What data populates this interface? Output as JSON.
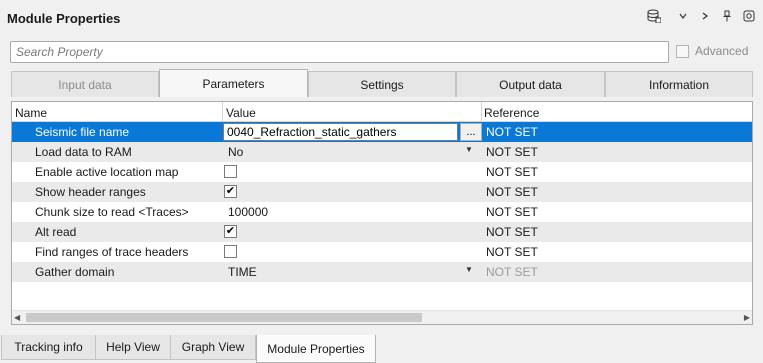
{
  "window": {
    "title": "Module Properties"
  },
  "toolbar_icons": [
    "database-icon",
    "chevron-down-icon",
    "chevron-right-icon",
    "pin-icon",
    "settings-icon"
  ],
  "search": {
    "placeholder": "Search Property"
  },
  "advanced": {
    "label": "Advanced",
    "checked": false
  },
  "tabs": [
    {
      "label": "Input data",
      "state": "disabled"
    },
    {
      "label": "Parameters",
      "state": "active"
    },
    {
      "label": "Settings",
      "state": "normal"
    },
    {
      "label": "Output data",
      "state": "normal"
    },
    {
      "label": "Information",
      "state": "normal"
    }
  ],
  "table": {
    "headers": {
      "name": "Name",
      "value": "Value",
      "reference": "Reference"
    },
    "rows": [
      {
        "name": "Seismic file name",
        "value": "0040_Refraction_static_gathers",
        "reference": "NOT SET",
        "editor": "text",
        "browse_label": "..."
      },
      {
        "name": "Load data to RAM",
        "value": "No",
        "reference": "NOT SET",
        "editor": "dropdown"
      },
      {
        "name": "Enable active location map",
        "value": "",
        "reference": "NOT SET",
        "editor": "checkbox",
        "checked": false
      },
      {
        "name": "Show header ranges",
        "value": "",
        "reference": "NOT SET",
        "editor": "checkbox",
        "checked": true
      },
      {
        "name": "Chunk size to read <Traces>",
        "value": "100000",
        "reference": "NOT SET",
        "editor": "text"
      },
      {
        "name": "Alt read",
        "value": "",
        "reference": "NOT SET",
        "editor": "checkbox",
        "checked": true
      },
      {
        "name": "Find ranges of trace headers",
        "value": "",
        "reference": "NOT SET",
        "editor": "checkbox",
        "checked": false
      },
      {
        "name": "Gather domain",
        "value": "TIME",
        "reference": "NOT SET",
        "editor": "dropdown",
        "reference_dim": true
      }
    ]
  },
  "bottom_tabs": [
    {
      "label": "Tracking info",
      "state": "normal"
    },
    {
      "label": "Help View",
      "state": "normal"
    },
    {
      "label": "Graph View",
      "state": "normal"
    },
    {
      "label": "Module Properties",
      "state": "active"
    }
  ],
  "colors": {
    "selection": "#0a78d7",
    "alt_row": "#eaeaea"
  }
}
